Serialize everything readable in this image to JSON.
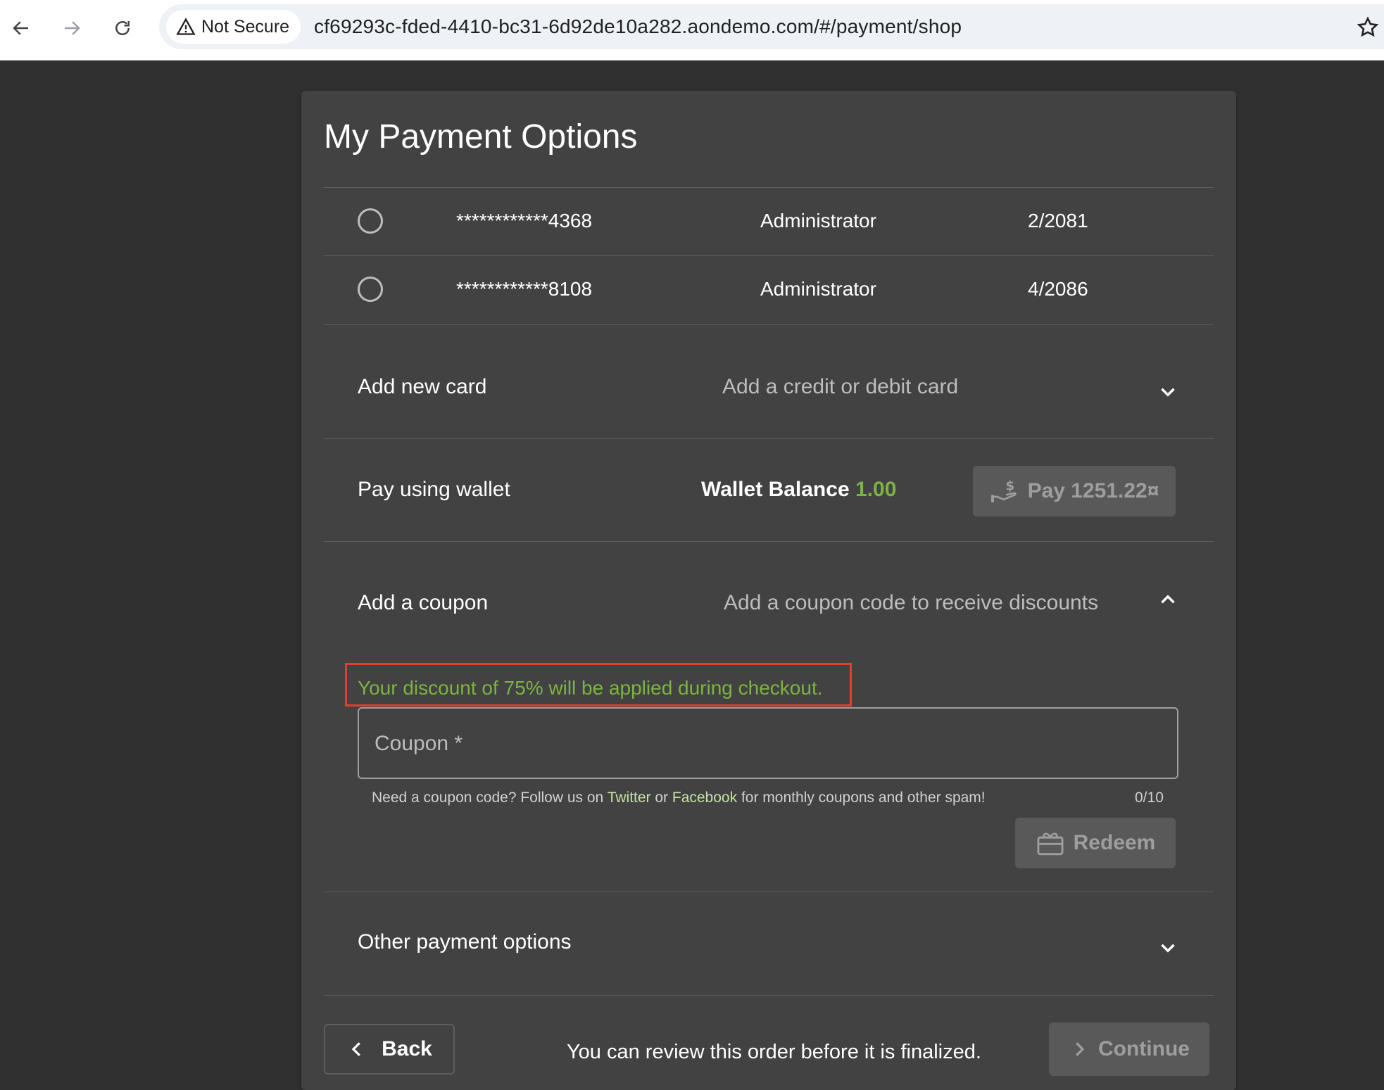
{
  "browser": {
    "security_label": "Not Secure",
    "url": "cf69293c-fded-4410-bc31-6d92de10a282.aondemo.com/#/payment/shop"
  },
  "page": {
    "title": "My Payment Options"
  },
  "saved_cards": [
    {
      "number": "************4368",
      "holder": "Administrator",
      "expiry": "2/2081"
    },
    {
      "number": "************8108",
      "holder": "Administrator",
      "expiry": "4/2086"
    }
  ],
  "add_card": {
    "label": "Add new card",
    "description": "Add a credit or debit card"
  },
  "wallet": {
    "label": "Pay using wallet",
    "balance_label": "Wallet Balance",
    "balance_value": "1.00",
    "pay_button": "Pay 1251.22¤"
  },
  "coupon": {
    "label": "Add a coupon",
    "description": "Add a coupon code to receive discounts",
    "discount_message": "Your discount of 75% will be applied during checkout.",
    "placeholder": "Coupon *",
    "hint_prefix": "Need a coupon code? Follow us on ",
    "hint_twitter": "Twitter",
    "hint_or": " or ",
    "hint_facebook": "Facebook",
    "hint_suffix": " for monthly coupons and other spam!",
    "counter": "0/10",
    "redeem_button": "Redeem"
  },
  "other_payment": {
    "label": "Other payment options"
  },
  "footer": {
    "back_button": "Back",
    "review_text": "You can review this order before it is finalized.",
    "continue_button": "Continue"
  },
  "colors": {
    "accent_green": "#7cb342",
    "highlight_red": "#e0402d"
  }
}
